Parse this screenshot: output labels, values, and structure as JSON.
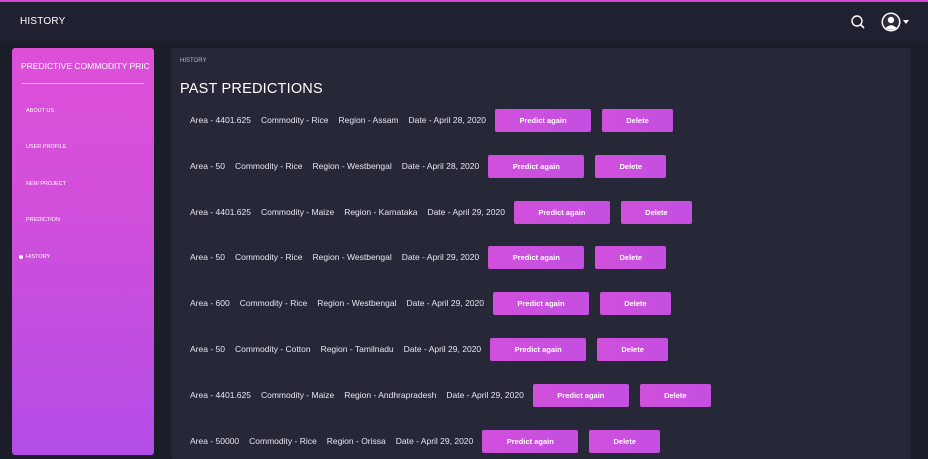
{
  "topbar": {
    "title": "HISTORY",
    "search_icon": "search-icon",
    "profile_icon": "user-avatar-icon"
  },
  "sidebar": {
    "brand": "PREDICTIVE COMMODITY PRIC",
    "items": [
      {
        "label": "ABOUT US",
        "active": false
      },
      {
        "label": "USER PROFILE",
        "active": false
      },
      {
        "label": "NEW PROJECT",
        "active": false
      },
      {
        "label": "PREDICTION",
        "active": false
      },
      {
        "label": "HISTORY",
        "active": true
      }
    ]
  },
  "main": {
    "breadcrumb": "HISTORY",
    "title": "PAST PREDICTIONS",
    "predict_label": "Predict again",
    "delete_label": "Delete",
    "predictions": [
      {
        "area": "Area - 4401.625",
        "commodity": "Commodity - Rice",
        "region": "Region - Assam",
        "date": "Date - April 28, 2020"
      },
      {
        "area": "Area - 50",
        "commodity": "Commodity - Rice",
        "region": "Region - Westbengal",
        "date": "Date - April 28, 2020"
      },
      {
        "area": "Area - 4401.625",
        "commodity": "Commodity - Maize",
        "region": "Region - Karnataka",
        "date": "Date - April 29, 2020"
      },
      {
        "area": "Area - 50",
        "commodity": "Commodity - Rice",
        "region": "Region - Westbengal",
        "date": "Date - April 29, 2020"
      },
      {
        "area": "Area - 600",
        "commodity": "Commodity - Rice",
        "region": "Region - Westbengal",
        "date": "Date - April 29, 2020"
      },
      {
        "area": "Area - 50",
        "commodity": "Commodity - Cotton",
        "region": "Region - Tamilnadu",
        "date": "Date - April 29, 2020"
      },
      {
        "area": "Area - 4401.625",
        "commodity": "Commodity - Maize",
        "region": "Region - Andhrapradesh",
        "date": "Date - April 29, 2020"
      },
      {
        "area": "Area - 50000",
        "commodity": "Commodity - Rice",
        "region": "Region - Orissa",
        "date": "Date - April 29, 2020"
      }
    ]
  },
  "colors": {
    "accent": "#d050dc",
    "background": "#1b1d28",
    "panel": "#262838"
  }
}
